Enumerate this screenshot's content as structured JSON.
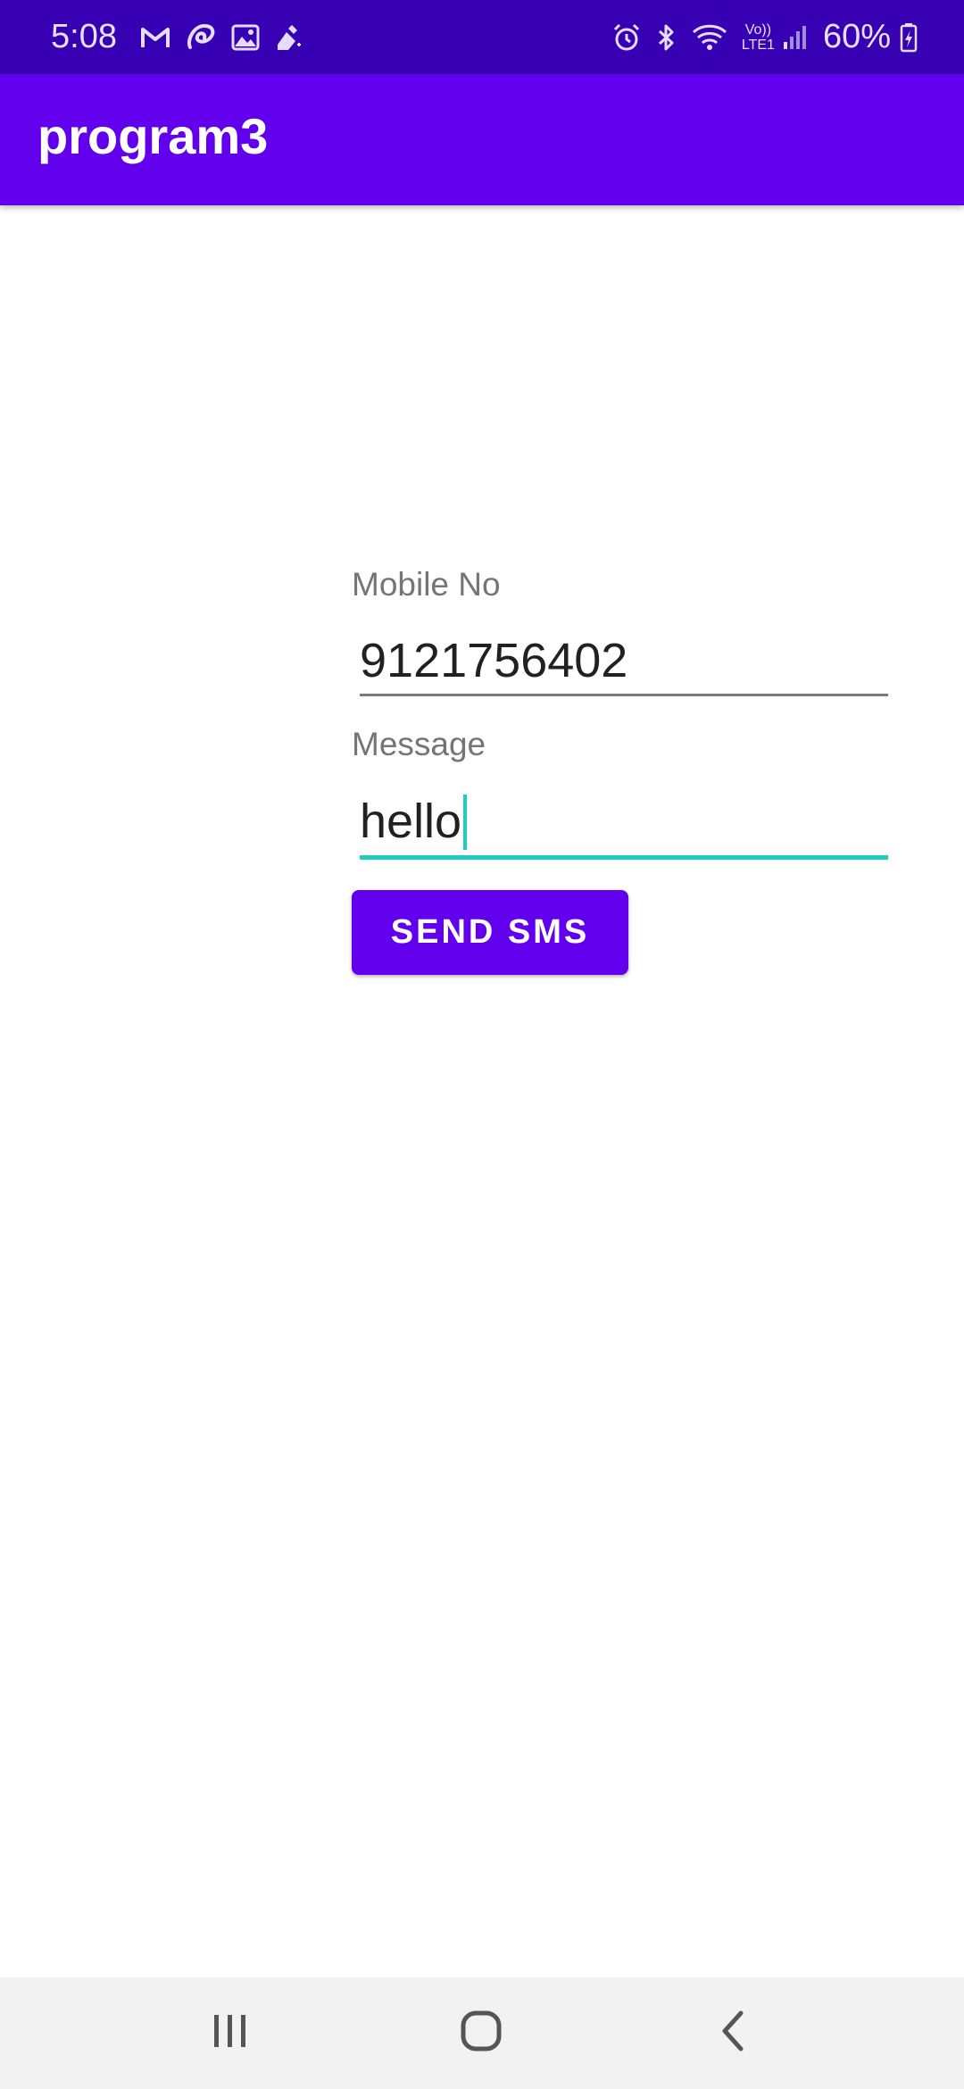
{
  "status_bar": {
    "time": "5:08",
    "left_icons": [
      "gmail-icon",
      "airtel-icon",
      "gallery-icon",
      "cleaner-icon"
    ],
    "right_icons": [
      "alarm-icon",
      "bluetooth-icon",
      "wifi-icon",
      "volte-icon",
      "signal-icon"
    ],
    "volte_text_top": "Vo))",
    "volte_text_bottom": "LTE1",
    "battery": "60%",
    "battery_icon": "battery-charging-icon"
  },
  "app_bar": {
    "title": "program3"
  },
  "form": {
    "mobile_label": "Mobile No",
    "mobile_value": "9121756402",
    "message_label": "Message",
    "message_value": "hello",
    "send_button": "SEND SMS"
  },
  "nav_bar": {
    "buttons": [
      "recents-icon",
      "home-icon",
      "back-icon"
    ]
  },
  "colors": {
    "status_bar": "#3700b3",
    "app_bar": "#6200ee",
    "accent": "#1fcdc0",
    "button": "#6200ee"
  }
}
